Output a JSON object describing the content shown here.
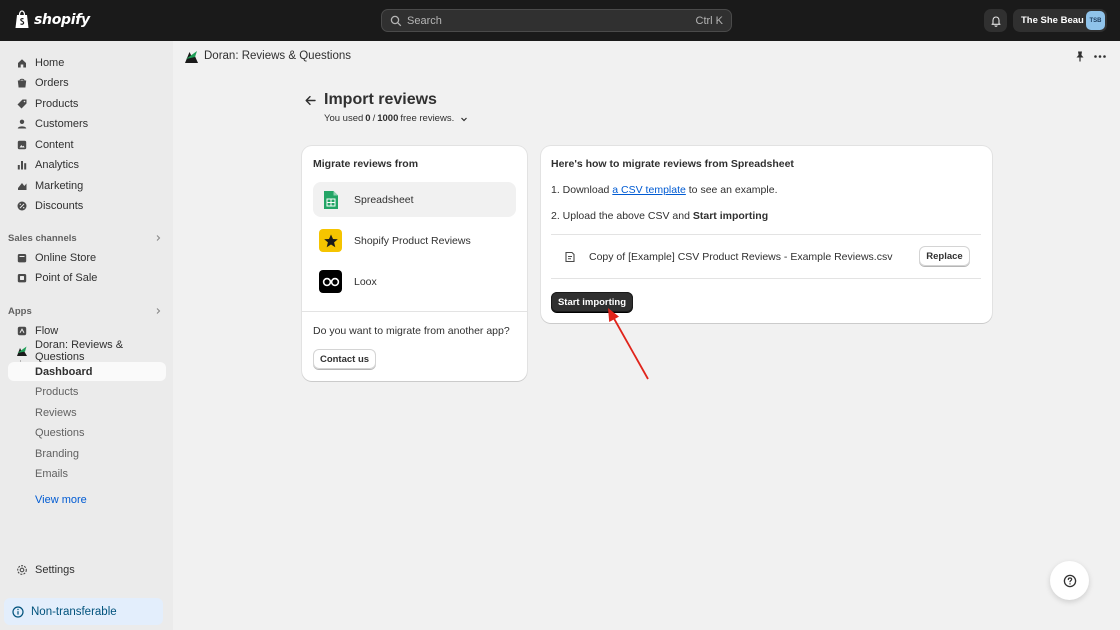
{
  "topbar": {
    "brand": "shopify",
    "search_placeholder": "Search",
    "search_shortcut": "Ctrl K",
    "store_name": "The She Beau",
    "store_initials": "TSB"
  },
  "sidebar": {
    "main_items": [
      {
        "label": "Home",
        "icon": "home-icon"
      },
      {
        "label": "Orders",
        "icon": "orders-icon"
      },
      {
        "label": "Products",
        "icon": "products-icon"
      },
      {
        "label": "Customers",
        "icon": "customers-icon"
      },
      {
        "label": "Content",
        "icon": "content-icon"
      },
      {
        "label": "Analytics",
        "icon": "analytics-icon"
      },
      {
        "label": "Marketing",
        "icon": "marketing-icon"
      },
      {
        "label": "Discounts",
        "icon": "discounts-icon"
      }
    ],
    "sales_channels_label": "Sales channels",
    "sales_channels": [
      {
        "label": "Online Store",
        "icon": "online-store-icon"
      },
      {
        "label": "Point of Sale",
        "icon": "pos-icon"
      }
    ],
    "apps_label": "Apps",
    "apps": [
      {
        "label": "Flow",
        "icon": "flow-icon"
      },
      {
        "label": "Doran: Reviews & Questions",
        "icon": "doran-icon"
      }
    ],
    "app_subitems": [
      "Dashboard",
      "Products",
      "Reviews",
      "Questions",
      "Branding",
      "Emails"
    ],
    "view_more": "View more",
    "settings": "Settings",
    "non_transferable": "Non-transferable"
  },
  "app_header": {
    "title": "Doran: Reviews & Questions"
  },
  "page": {
    "title": "Import reviews",
    "usage_prefix": "You used",
    "usage_used": "0",
    "usage_sep": "/",
    "usage_total": "1000",
    "usage_suffix": "free reviews."
  },
  "migrate_card": {
    "title": "Migrate reviews from",
    "sources": [
      {
        "label": "Spreadsheet",
        "icon": "spreadsheet-icon"
      },
      {
        "label": "Shopify Product Reviews",
        "icon": "star-icon"
      },
      {
        "label": "Loox",
        "icon": "loox-icon"
      }
    ],
    "question": "Do you want to migrate from another app?",
    "contact_button": "Contact us"
  },
  "howto_card": {
    "title": "Here's how to migrate reviews from Spreadsheet",
    "step1_prefix": "1. Download",
    "step1_link": "a CSV template",
    "step1_suffix": "to see an example.",
    "step2_prefix": "2. Upload the above CSV and",
    "step2_bold": "Start importing",
    "file_name": "Copy of [Example] CSV Product Reviews - Example Reviews.csv",
    "replace_button": "Replace",
    "start_button": "Start importing"
  },
  "colors": {
    "topbar": "#1a1a1a",
    "link": "#005bd3",
    "annotation_arrow": "#e0241b"
  }
}
